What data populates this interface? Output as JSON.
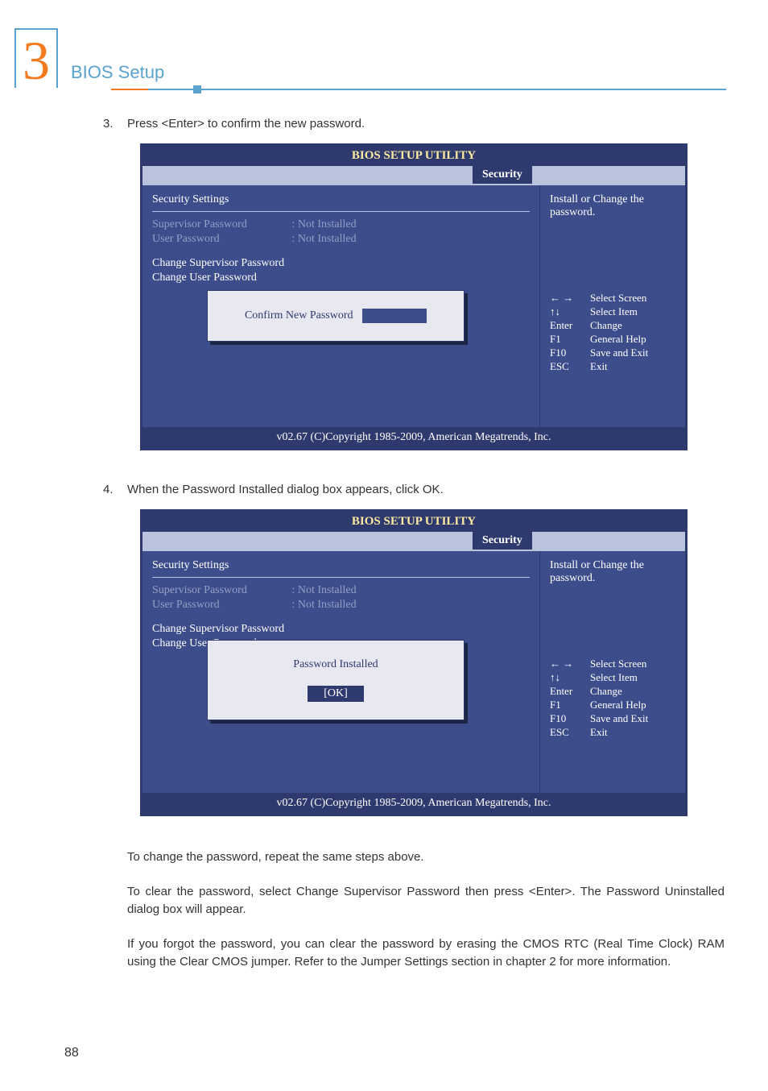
{
  "chapter": {
    "number": "3",
    "title": "BIOS Setup"
  },
  "steps": {
    "s3": {
      "num": "3.",
      "text": "Press <Enter> to confirm the new password."
    },
    "s4": {
      "num": "4.",
      "text": "When the Password Installed dialog box appears, click OK."
    }
  },
  "bios": {
    "title": "BIOS SETUP UTILITY",
    "tab": "Security",
    "section_header": "Security Settings",
    "rows": {
      "supervisor": {
        "label": "Supervisor Password",
        "value": ": Not Installed"
      },
      "user": {
        "label": "User Password",
        "value": ": Not Installed"
      }
    },
    "menu": {
      "change_sup": "Change Supervisor Password",
      "change_user": "Change User Password"
    },
    "help_top": "Install or Change the password.",
    "keys": {
      "lr": {
        "k": "← →",
        "d": "Select Screen"
      },
      "ud": {
        "k": "↑↓",
        "d": "Select Item"
      },
      "ent": {
        "k": "Enter",
        "d": "Change"
      },
      "f1": {
        "k": "F1",
        "d": "General Help"
      },
      "f10": {
        "k": "F10",
        "d": "Save and Exit"
      },
      "esc": {
        "k": "ESC",
        "d": "Exit"
      }
    },
    "footer": "v02.67 (C)Copyright 1985-2009, American Megatrends, Inc.",
    "dialog1": {
      "label": "Confirm New Password"
    },
    "dialog2": {
      "label": "Password Installed",
      "ok": "[OK]"
    }
  },
  "paras": {
    "p1": "To change the password, repeat the same steps above.",
    "p2": "To clear the password, select Change Supervisor Password then press <Enter>. The Password Uninstalled dialog box will appear.",
    "p3": "If you forgot the password, you can clear the password by erasing the CMOS RTC (Real Time Clock) RAM using the Clear CMOS jumper. Refer to the Jumper Settings section in chapter 2 for more information."
  },
  "page_number": "88"
}
